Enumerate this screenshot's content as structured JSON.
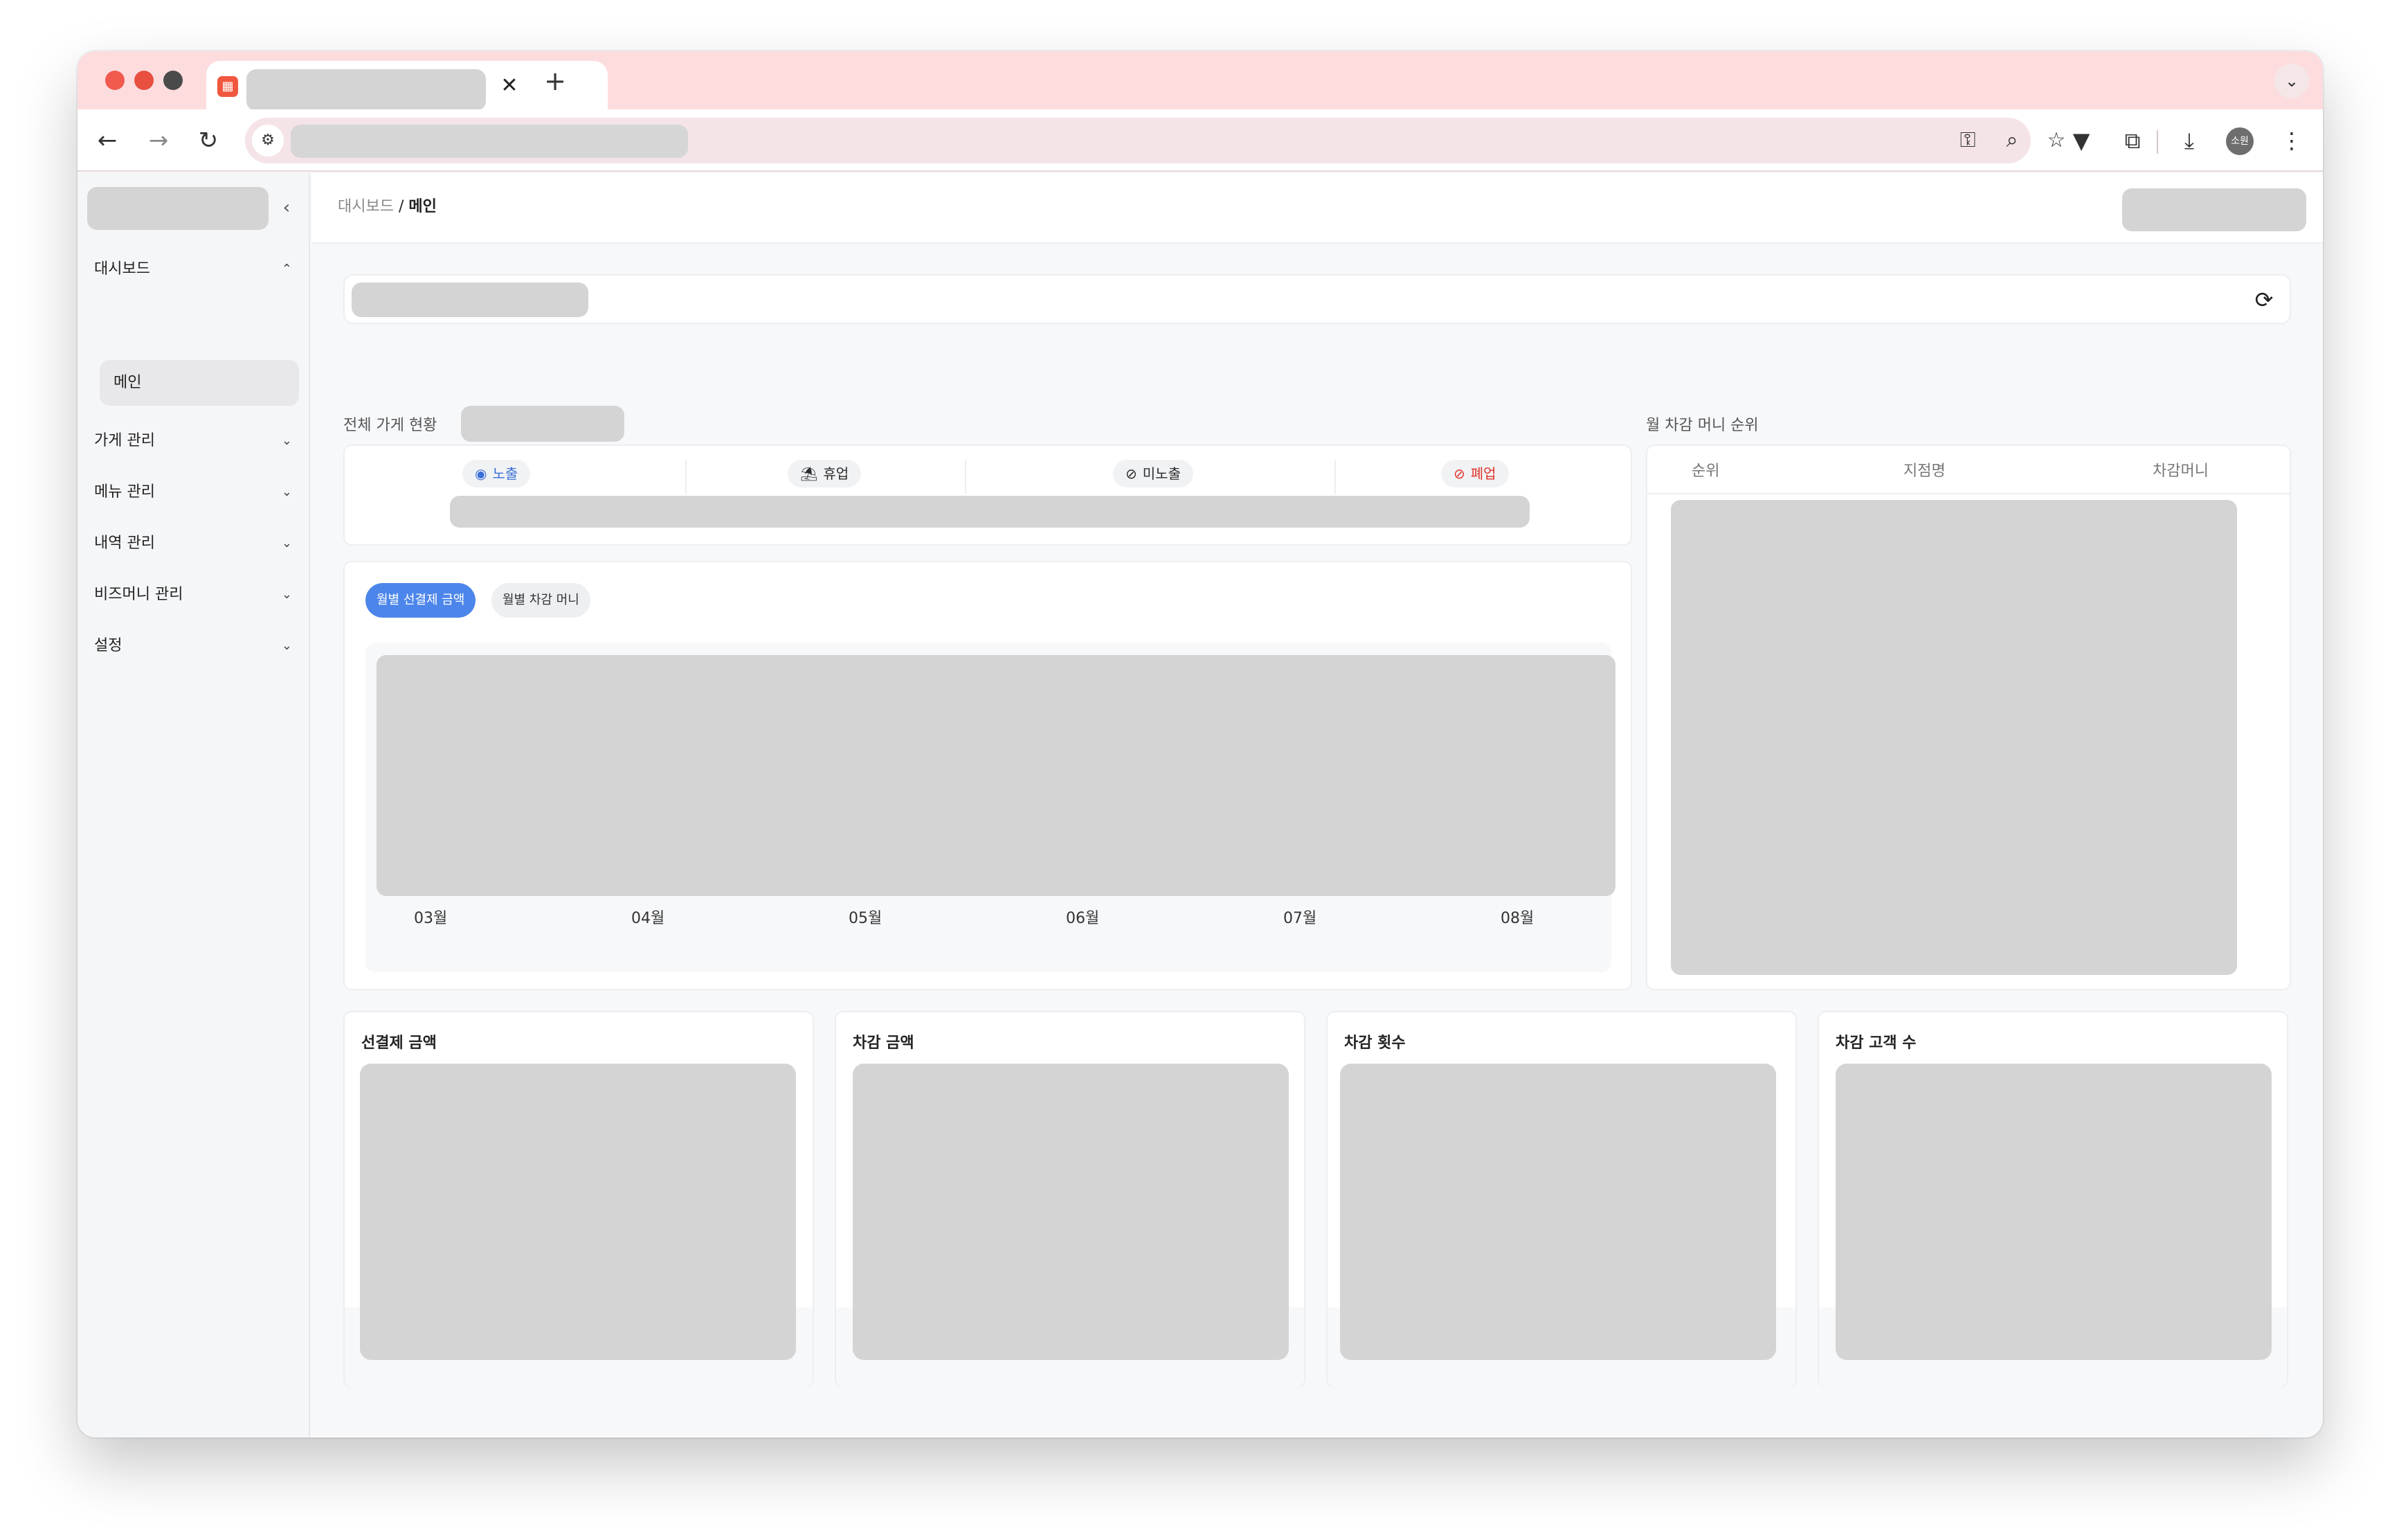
{
  "browser": {
    "tab_close": "✕",
    "new_tab": "+",
    "tab_menu": "⌄",
    "profile_initials": "소원"
  },
  "sidebar": {
    "collapse": "‹",
    "items": [
      {
        "label": "대시보드",
        "chev": "⌃"
      },
      {
        "label": "가게 관리",
        "chev": "⌄"
      },
      {
        "label": "메뉴 관리",
        "chev": "⌄"
      },
      {
        "label": "내역 관리",
        "chev": "⌄"
      },
      {
        "label": "비즈머니 관리",
        "chev": "⌄"
      },
      {
        "label": "설정",
        "chev": "⌄"
      }
    ],
    "sub_item": "메인"
  },
  "breadcrumb": {
    "parent": "대시보드",
    "separator": " / ",
    "current": "메인"
  },
  "store_status": {
    "title": "전체 가게 현황",
    "badges": [
      {
        "label": "노출",
        "icon": "eye-icon",
        "color": "#3b6fd8"
      },
      {
        "label": "휴업",
        "icon": "beach-umbrella-icon",
        "color": "#444444"
      },
      {
        "label": "미노출",
        "icon": "eye-off-icon",
        "color": "#444444"
      },
      {
        "label": "폐업",
        "icon": "ban-icon",
        "color": "#e0352b"
      }
    ]
  },
  "chart": {
    "tabs": [
      {
        "label": "월별 선결제 금액",
        "active": true
      },
      {
        "label": "월별 차감 머니",
        "active": false
      }
    ],
    "accent": "#4d86ea"
  },
  "chart_data": {
    "type": "line",
    "categories": [
      "03월",
      "04월",
      "05월",
      "06월",
      "07월",
      "08월"
    ],
    "title": "",
    "xlabel": "",
    "ylabel": ""
  },
  "ranking": {
    "title": "월 차감 머니 순위",
    "columns": [
      "순위",
      "지점명",
      "차감머니"
    ]
  },
  "stats": [
    {
      "title": "선결제 금액"
    },
    {
      "title": "차감 금액"
    },
    {
      "title": "차감 횟수"
    },
    {
      "title": "차감 고객 수"
    }
  ]
}
